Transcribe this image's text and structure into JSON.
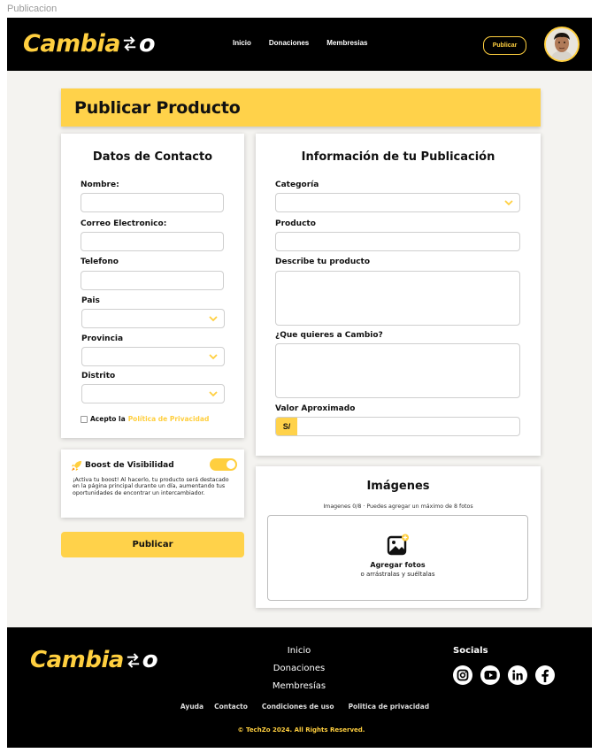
{
  "frame_label": "Publicacion",
  "header": {
    "logo_text": "Cambia",
    "logo_suffix": "o",
    "nav": [
      "Inicio",
      "Donaciones",
      "Membresias"
    ],
    "publish_button": "Publicar"
  },
  "page_title": "Publicar Producto",
  "contact": {
    "title": "Datos de Contacto",
    "fields": {
      "nombre": {
        "label": "Nombre:",
        "value": ""
      },
      "correo": {
        "label": "Correo Electronico:",
        "value": ""
      },
      "telefono": {
        "label": "Telefono",
        "value": ""
      },
      "pais": {
        "label": "Pais",
        "value": ""
      },
      "provincia": {
        "label": "Provincia",
        "value": ""
      },
      "distrito": {
        "label": "Distrito",
        "value": ""
      }
    },
    "consent_text": "Acepto la",
    "consent_link": "Política de Privacidad",
    "consent_checked": false
  },
  "info": {
    "title": "Información de tu Publicación",
    "fields": {
      "categoria": {
        "label": "Categoría",
        "value": ""
      },
      "producto": {
        "label": "Producto",
        "value": ""
      },
      "descripcion": {
        "label": "Describe tu producto",
        "value": ""
      },
      "cambio": {
        "label": "¿Que quieres a Cambio?",
        "value": ""
      },
      "valor": {
        "label": "Valor Aproximado",
        "prefix": "S/",
        "value": ""
      }
    }
  },
  "boost": {
    "title": "Boost de Visibilidad",
    "enabled": true,
    "description": "¡Activa tu boost! Al hacerlo, tu producto será destacado en la página principal durante un día, aumentando tus oportunidades de encontrar un intercambiador."
  },
  "submit_button": "Publicar",
  "images": {
    "title": "Imágenes",
    "note": "Imagenes 0/8 · Puedes agregar un máximo de 8 fotos",
    "drop_main": "Agregar fotos",
    "drop_sub": "o arrástralas y suéltalas"
  },
  "footer": {
    "logo_text": "Cambia",
    "logo_suffix": "o",
    "links": [
      "Inicio",
      "Donaciones",
      "Membresías"
    ],
    "socials_title": "Socials",
    "social_icons": [
      "instagram-icon",
      "youtube-icon",
      "linkedin-icon",
      "facebook-icon"
    ],
    "bottom_links": [
      "Ayuda",
      "Contacto",
      "Condiciones de uso",
      "Politica de privacidad"
    ],
    "copyright": "© TechZo 2024. All Rights Reserved."
  },
  "colors": {
    "accent": "#ffd24a",
    "dark": "#000000",
    "page_bg": "#f4f3f0"
  }
}
